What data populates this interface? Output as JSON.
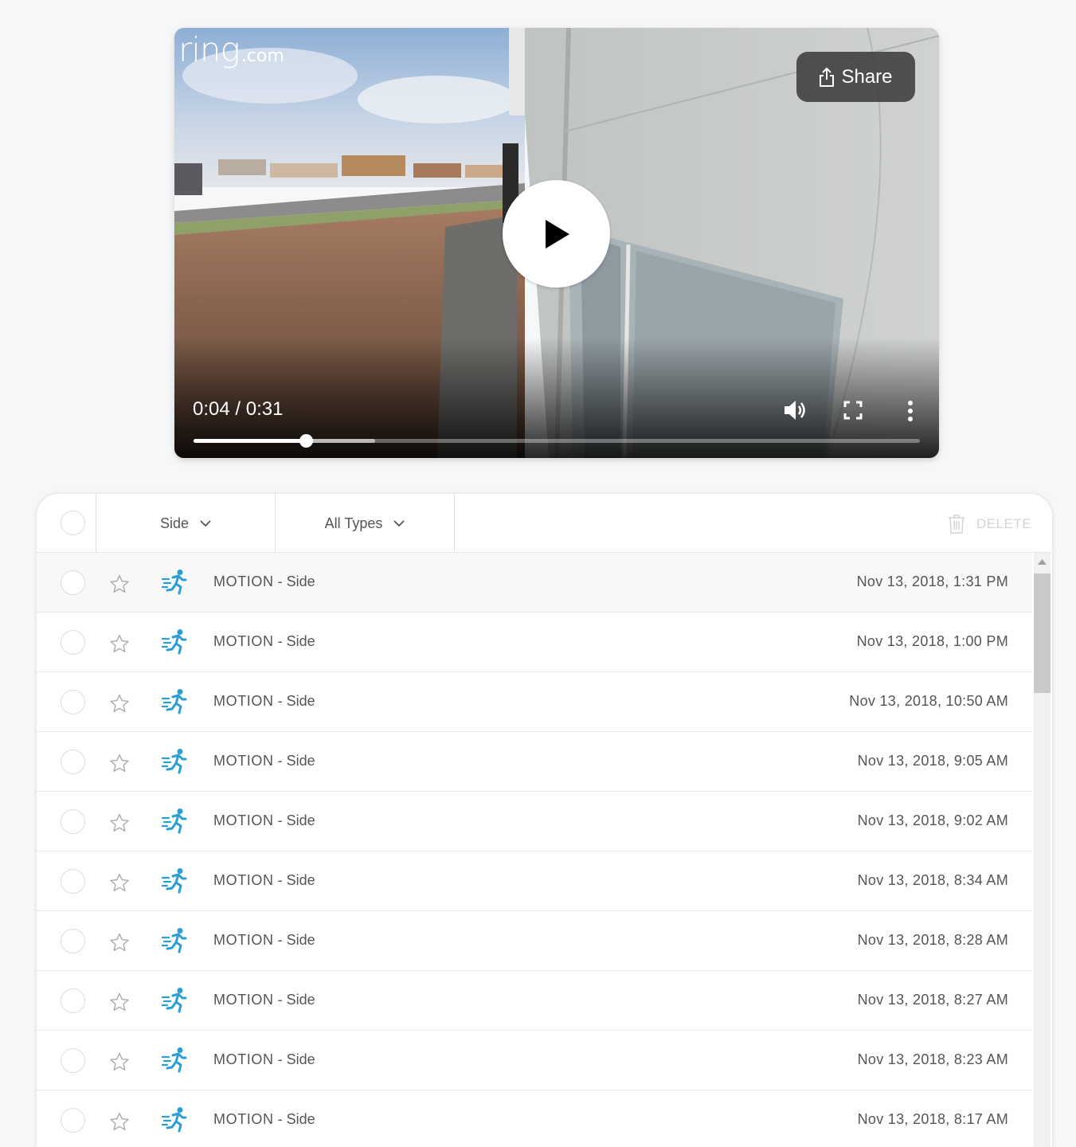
{
  "player": {
    "logo_main": "ring",
    "logo_suffix": ".com",
    "share_label": "Share",
    "current_time": "0:04",
    "duration": "0:31",
    "time_display": "0:04 / 0:31",
    "played_fraction": 0.155,
    "buffered_fraction": 0.25,
    "icons": [
      "share-icon",
      "play-icon",
      "volume-icon",
      "fullscreen-icon",
      "more-options-icon"
    ]
  },
  "toolbar": {
    "device_filter": "Side",
    "type_filter": "All Types",
    "delete_label": "DELETE"
  },
  "events": [
    {
      "kind": "MOTION",
      "device": "Side",
      "date": "Nov 13, 2018, 1:31 PM",
      "selected": true
    },
    {
      "kind": "MOTION",
      "device": "Side",
      "date": "Nov 13, 2018, 1:00 PM"
    },
    {
      "kind": "MOTION",
      "device": "Side",
      "date": "Nov 13, 2018, 10:50 AM"
    },
    {
      "kind": "MOTION",
      "device": "Side",
      "date": "Nov 13, 2018, 9:05 AM"
    },
    {
      "kind": "MOTION",
      "device": "Side",
      "date": "Nov 13, 2018, 9:02 AM"
    },
    {
      "kind": "MOTION",
      "device": "Side",
      "date": "Nov 13, 2018, 8:34 AM"
    },
    {
      "kind": "MOTION",
      "device": "Side",
      "date": "Nov 13, 2018, 8:28 AM"
    },
    {
      "kind": "MOTION",
      "device": "Side",
      "date": "Nov 13, 2018, 8:27 AM"
    },
    {
      "kind": "MOTION",
      "device": "Side",
      "date": "Nov 13, 2018, 8:23 AM"
    },
    {
      "kind": "MOTION",
      "device": "Side",
      "date": "Nov 13, 2018, 8:17 AM"
    }
  ],
  "colors": {
    "motion_icon": "#2a9fd6",
    "panel_bg": "#ffffff",
    "page_bg": "#f6f7f9",
    "text": "#555555"
  }
}
